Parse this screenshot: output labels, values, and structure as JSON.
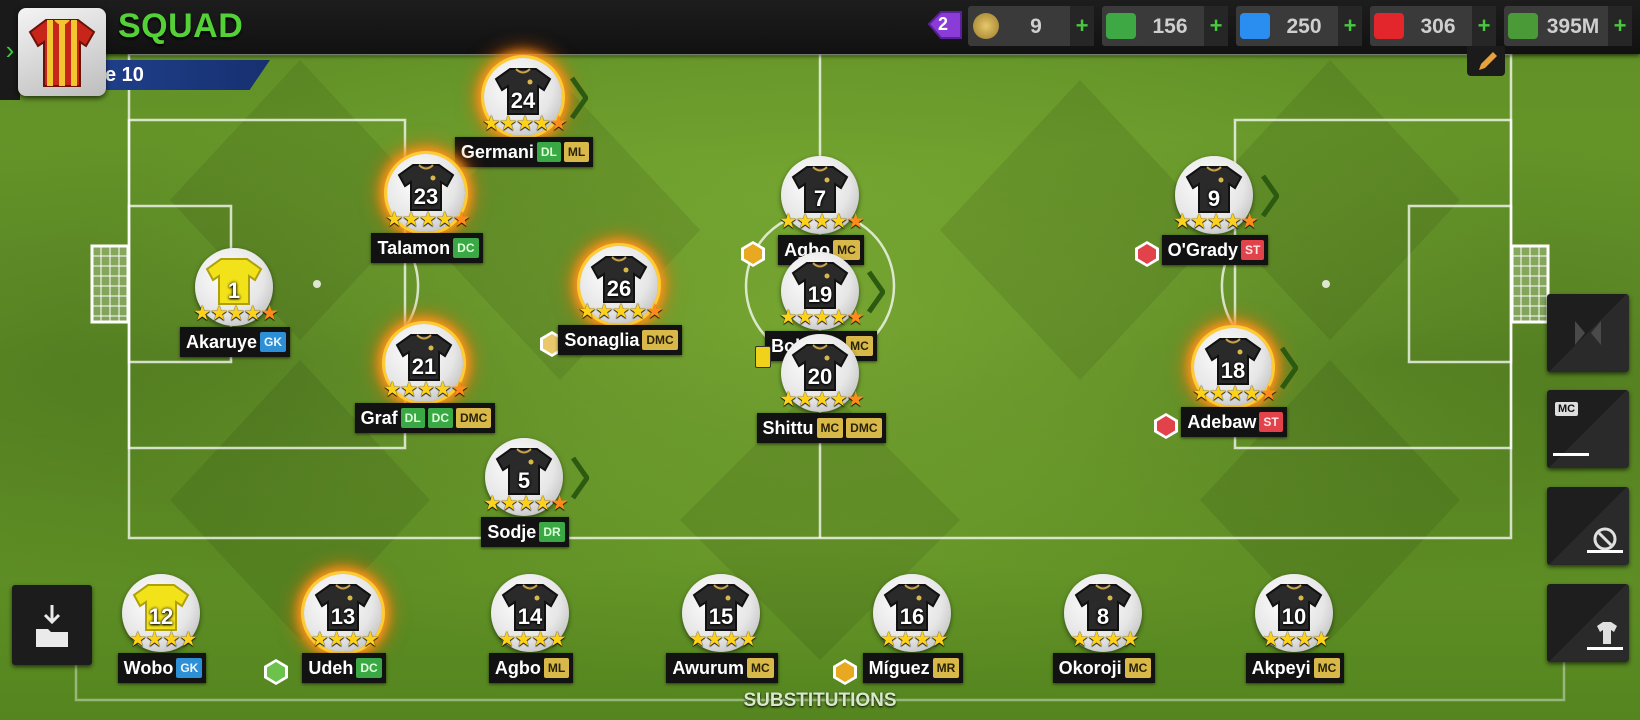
{
  "header": {
    "title": "SQUAD",
    "level_text": "e 10",
    "notification_count": "2"
  },
  "currencies": [
    {
      "name": "tokens",
      "value": "9",
      "icon": "token-icon",
      "color": "#c9a24a"
    },
    {
      "name": "cash",
      "value": "156",
      "icon": "cash-icon",
      "color": "#4caf50"
    },
    {
      "name": "energy",
      "value": "250",
      "icon": "lightning-icon",
      "color": "#2a8ef0"
    },
    {
      "name": "health",
      "value": "306",
      "icon": "medical-cross-icon",
      "color": "#e2262b"
    },
    {
      "name": "money",
      "value": "395M",
      "icon": "banknote-icon",
      "color": "#4a9a38"
    }
  ],
  "starters": [
    {
      "id": "p24",
      "number": "24",
      "name": "Germani",
      "positions": [
        "DL",
        "ML"
      ],
      "stars": 4.5,
      "fire": true,
      "arrow": true
    },
    {
      "id": "p23",
      "number": "23",
      "name": "Talamon",
      "positions": [
        "DC"
      ],
      "stars": 4.5,
      "fire": true,
      "arrow": false
    },
    {
      "id": "p7",
      "number": "7",
      "name": "Agbo",
      "positions": [
        "MC"
      ],
      "stars": 4.5,
      "fire": false,
      "arrow": false,
      "badge": "gold-hex-badge-icon"
    },
    {
      "id": "p9",
      "number": "9",
      "name": "O'Grady",
      "positions": [
        "ST"
      ],
      "stars": 4.5,
      "fire": false,
      "arrow": true,
      "badge": "red-locked-hex-icon"
    },
    {
      "id": "p1",
      "number": "1",
      "name": "Akaruye",
      "positions": [
        "GK"
      ],
      "stars": 4.5,
      "fire": false,
      "arrow": false,
      "kit": "yellow"
    },
    {
      "id": "p26",
      "number": "26",
      "name": "Sonaglia",
      "positions": [
        "DMC"
      ],
      "stars": 4.5,
      "fire": true,
      "arrow": false,
      "badge": "locked-trainer-icon"
    },
    {
      "id": "p19",
      "number": "19",
      "name": "Bologne",
      "positions": [
        "MC"
      ],
      "stars": 4.5,
      "fire": false,
      "arrow": true
    },
    {
      "id": "p21",
      "number": "21",
      "name": "Graf",
      "positions": [
        "DL",
        "DC",
        "DMC"
      ],
      "stars": 4.5,
      "fire": true,
      "arrow": false
    },
    {
      "id": "p20",
      "number": "20",
      "name": "Shittu",
      "positions": [
        "MC",
        "DMC"
      ],
      "stars": 4.5,
      "fire": false,
      "arrow": false,
      "card": "yellow"
    },
    {
      "id": "p18",
      "number": "18",
      "name": "Adebaw",
      "positions": [
        "ST"
      ],
      "stars": 4.5,
      "fire": true,
      "arrow": true,
      "badge": "red-target-hex-icon"
    },
    {
      "id": "p5",
      "number": "5",
      "name": "Sodje",
      "positions": [
        "DR"
      ],
      "stars": 4.5,
      "fire": false,
      "arrow": true
    }
  ],
  "substitutes": [
    {
      "id": "s12",
      "number": "12",
      "name": "Wobo",
      "positions": [
        "GK"
      ],
      "stars": 4,
      "kit": "yellow"
    },
    {
      "id": "s13",
      "number": "13",
      "name": "Udeh",
      "positions": [
        "DC"
      ],
      "stars": 4,
      "fire": true,
      "badge": "green-locked-hex-icon"
    },
    {
      "id": "s14",
      "number": "14",
      "name": "Agbo",
      "positions": [
        "ML"
      ],
      "stars": 4
    },
    {
      "id": "s15",
      "number": "15",
      "name": "Awurum",
      "positions": [
        "MC"
      ],
      "stars": 4
    },
    {
      "id": "s16",
      "number": "16",
      "name": "Míguez",
      "positions": [
        "MR"
      ],
      "stars": 4,
      "badge": "gold-yof-hex-icon"
    },
    {
      "id": "s8",
      "number": "8",
      "name": "Okoroji",
      "positions": [
        "MC"
      ],
      "stars": 4
    },
    {
      "id": "s10",
      "number": "10",
      "name": "Akpeyi",
      "positions": [
        "MC"
      ],
      "stars": 4
    }
  ],
  "side_panel": {
    "mc_label": "MC"
  },
  "substitutions_label": "SUBSTITUTIONS",
  "colors": {
    "title": "#55d138",
    "gk": "#2d8fd6",
    "defender": "#3aa844",
    "midfielder": "#d9b84a",
    "attacker": "#e2434a",
    "star": "#ffd21a"
  }
}
